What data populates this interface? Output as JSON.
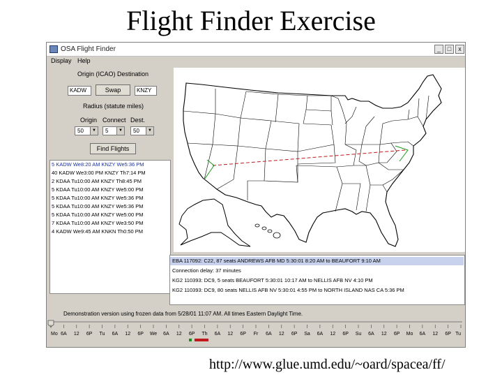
{
  "slide": {
    "title": "Flight Finder Exercise",
    "url": "http://www.glue.umd.edu/~oard/spacea/ff/"
  },
  "window": {
    "title": "OSA Flight Finder",
    "min_glyph": "_",
    "max_glyph": "□",
    "close_glyph": "x"
  },
  "menu": [
    "Display",
    "Help"
  ],
  "controls": {
    "origin_dest_label": "Origin (ICAO) Destination",
    "origin_value": "KADW",
    "swap_label": "Swap",
    "dest_value": "KNZY",
    "radius_label": "Radius (statute miles)",
    "origin_label": "Origin",
    "connect_label": "Connect",
    "dest_label": "Dest.",
    "origin_radius": "50",
    "connect_radius": "5",
    "dest_radius": "50",
    "find_label": "Find Flights"
  },
  "results": [
    "5 KADW We8:20 AM KNZY We5:36 PM",
    "40 KADW We3:00 PM KNZY Th7:14 PM",
    "2 KDAA Tu10:00 AM KNZY Th8:45 PM",
    "5 KDAA Tu10:00 AM KNZY We5:00 PM",
    "5 KDAA Tu10:00 AM KNZY We5:36 PM",
    "5 KDAA Tu10:00 AM KNZY We5:36 PM",
    "5 KDAA Tu10:00 AM KNZY We5:00 PM",
    "7 KDAA Tu10:00 AM KNZY We3:50 PM",
    "4 KADW We9:45 AM KNKN Th0:50 PM"
  ],
  "details": [
    "EBA 117092: C22, 87 seats ANDREWS AFB MD 5:30:01 8:20 AM to BEAUFORT 9:10 AM",
    "Connection delay: 37 minutes",
    "KG2 110393: DC9, 5 seats BEAUFORT 5:30:01 10:17 AM to NELLIS AFB NV 4:10 PM",
    "KG2 110393: DC9, 80 seats NELLIS AFB NV 5:30:01 4:55 PM to NORTH ISLAND NAS CA 5:36 PM"
  ],
  "status": "Demonstration version using frozen data from 5/28/01 11:07 AM. All times Eastern Daylight Time.",
  "timeline": {
    "labels": [
      "Mo",
      "6A",
      "12",
      "6P",
      "Tu",
      "6A",
      "12",
      "6P",
      "We",
      "6A",
      "12",
      "6P",
      "Th",
      "6A",
      "12",
      "6P",
      "Fr",
      "6A",
      "12",
      "6P",
      "Sa",
      "6A",
      "12",
      "6P",
      "Su",
      "6A",
      "12",
      "6P",
      "Mo",
      "6A",
      "12",
      "6P",
      "Tu"
    ],
    "marker_color": "#c0181c",
    "marker2_color": "#1a8c1a"
  },
  "colors": {
    "route_red": "#c0181c",
    "route_green": "#1a9a1a",
    "selection": "#c8d2ec"
  }
}
